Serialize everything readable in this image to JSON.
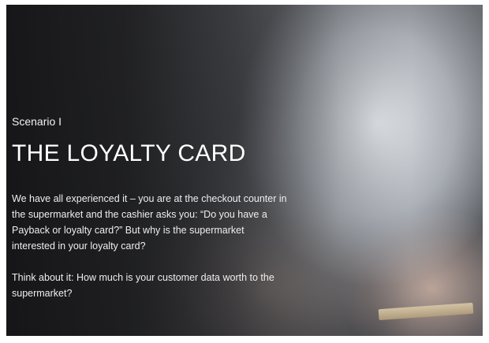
{
  "scenario": {
    "eyebrow": "Scenario I",
    "title": "THE LOYALTY CARD",
    "paragraphs": [
      "We have all experienced it – you are at the checkout counter in the supermarket and the cashier asks you: “Do you have a Payback or loyalty card?” But why is the supermarket interested in your loyalty card?",
      "Think about it: How much is your customer data worth to the supermarket?"
    ]
  }
}
